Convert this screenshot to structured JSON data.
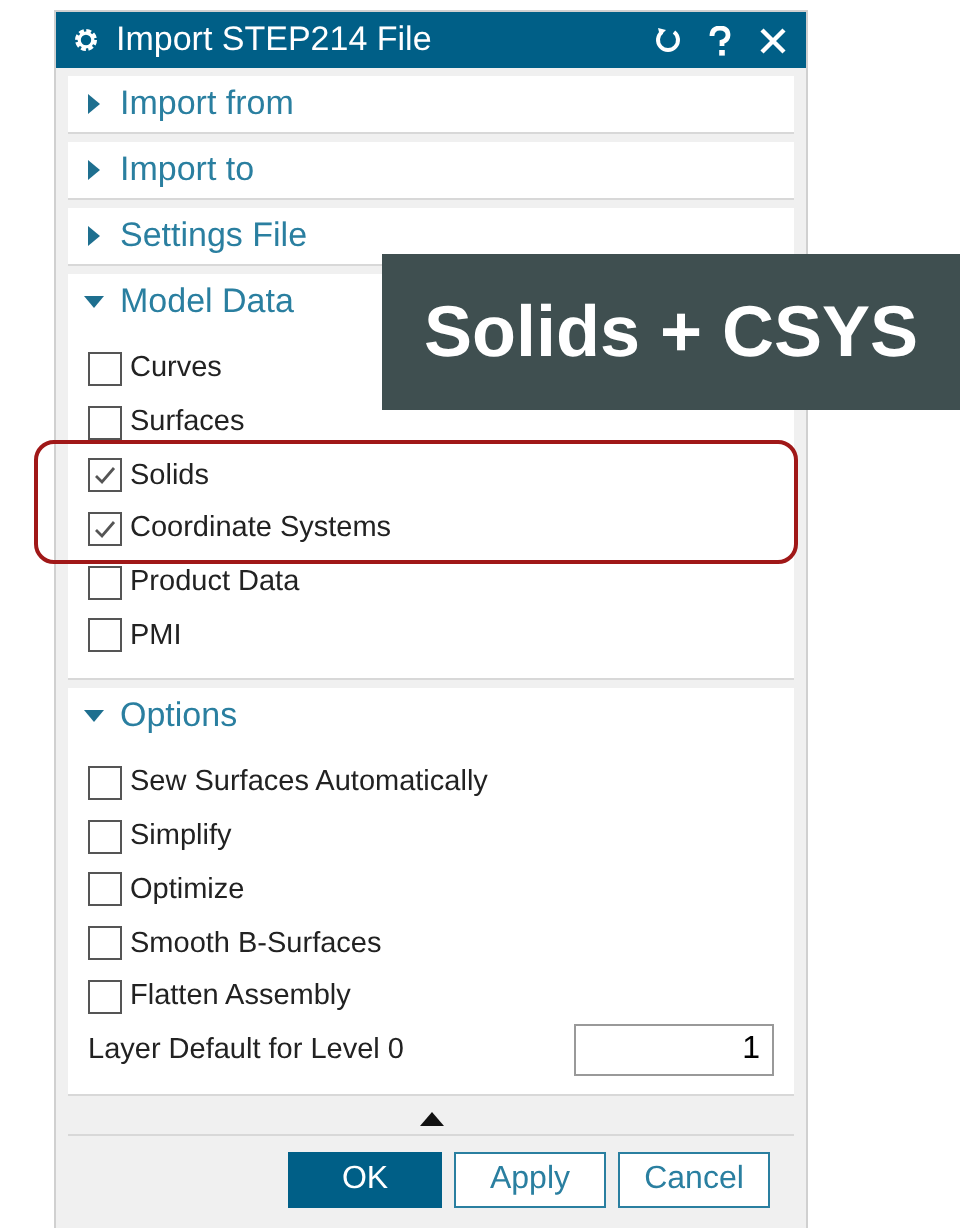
{
  "window": {
    "title": "Import STEP214 File"
  },
  "sections": [
    {
      "title": "Import from",
      "expanded": false
    },
    {
      "title": "Import to",
      "expanded": false
    },
    {
      "title": "Settings File",
      "expanded": false
    },
    {
      "title": "Model Data",
      "expanded": true,
      "items": [
        {
          "kind": "checkbox",
          "label": "Curves",
          "checked": false
        },
        {
          "kind": "checkbox",
          "label": "Surfaces",
          "checked": false
        },
        {
          "kind": "checkbox",
          "label": "Solids",
          "checked": true
        },
        {
          "kind": "checkbox",
          "label": "Coordinate Systems",
          "checked": true
        },
        {
          "kind": "checkbox",
          "label": "Product Data",
          "checked": false
        },
        {
          "kind": "checkbox",
          "label": "PMI",
          "checked": false
        }
      ]
    },
    {
      "title": "Options",
      "expanded": true,
      "items": [
        {
          "kind": "checkbox",
          "label": "Sew Surfaces Automatically",
          "checked": false
        },
        {
          "kind": "checkbox",
          "label": "Simplify",
          "checked": false
        },
        {
          "kind": "checkbox",
          "label": "Optimize",
          "checked": false
        },
        {
          "kind": "checkbox",
          "label": "Smooth B-Surfaces",
          "checked": false
        },
        {
          "kind": "checkbox",
          "label": "Flatten Assembly",
          "checked": false
        },
        {
          "kind": "number",
          "label": "Layer Default for Level 0",
          "value": "1"
        }
      ]
    }
  ],
  "buttons": [
    {
      "label": "OK",
      "default": true
    },
    {
      "label": "Apply",
      "default": false
    },
    {
      "label": "Cancel",
      "default": false
    }
  ],
  "callout": {
    "text": "Solids + CSYS"
  }
}
